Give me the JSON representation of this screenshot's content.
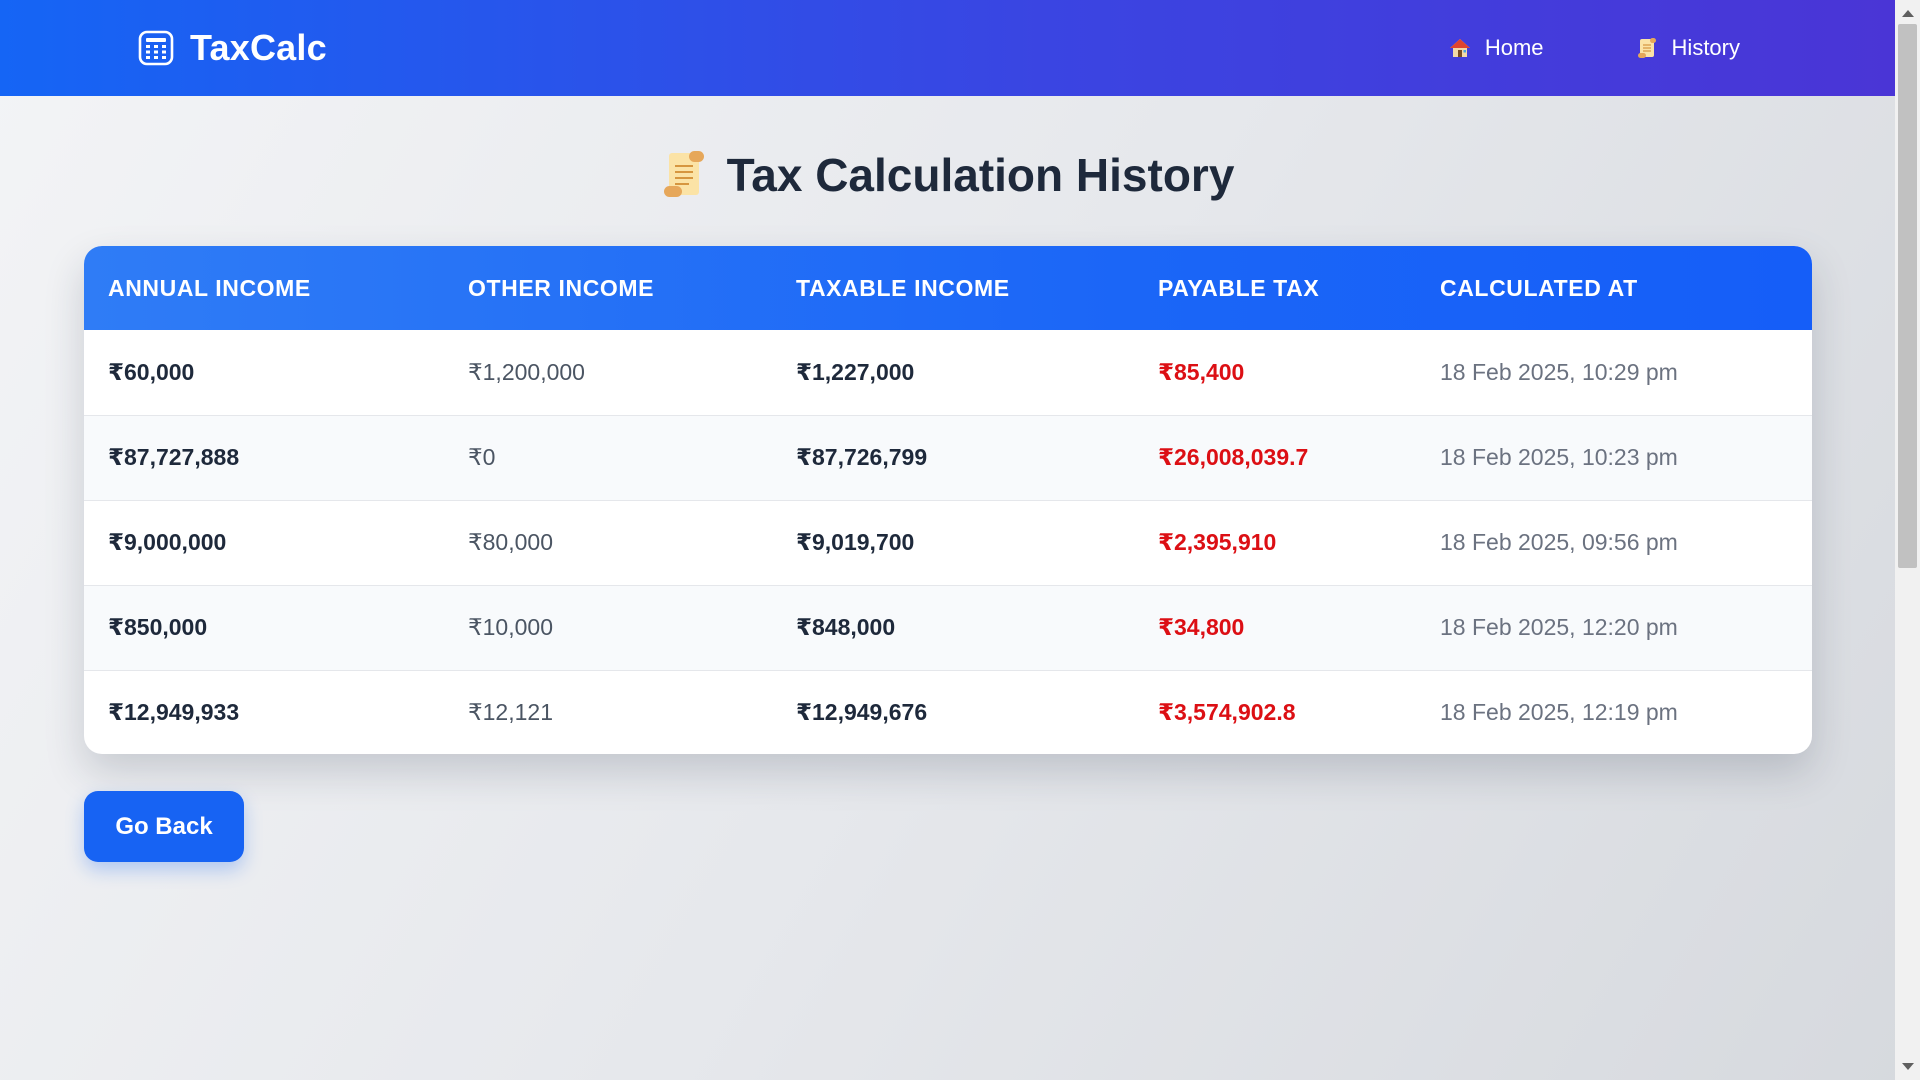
{
  "navbar": {
    "brand": "TaxCalc",
    "brand_icon": "calculator-icon",
    "links": [
      {
        "label": "Home",
        "icon": "house-icon"
      },
      {
        "label": "History",
        "icon": "scroll-icon"
      }
    ]
  },
  "page": {
    "title": "Tax Calculation History",
    "title_icon": "scroll-icon"
  },
  "table": {
    "headers": [
      "Annual Income",
      "Other Income",
      "Taxable Income",
      "Payable Tax",
      "Calculated At"
    ],
    "rows": [
      [
        "₹60,000",
        "₹1,200,000",
        "₹1,227,000",
        "₹85,400",
        "18 Feb 2025, 10:29 pm"
      ],
      [
        "₹87,727,888",
        "₹0",
        "₹87,726,799",
        "₹26,008,039.7",
        "18 Feb 2025, 10:23 pm"
      ],
      [
        "₹9,000,000",
        "₹80,000",
        "₹9,019,700",
        "₹2,395,910",
        "18 Feb 2025, 09:56 pm"
      ],
      [
        "₹850,000",
        "₹10,000",
        "₹848,000",
        "₹34,800",
        "18 Feb 2025, 12:20 pm"
      ],
      [
        "₹12,949,933",
        "₹12,121",
        "₹12,949,676",
        "₹3,574,902.8",
        "18 Feb 2025, 12:19 pm"
      ]
    ]
  },
  "actions": {
    "go_back_label": "Go Back"
  },
  "colors": {
    "nav_gradient_start": "#1565f5",
    "nav_gradient_end": "#4a35d6",
    "header_blue": "#1b66f7",
    "payable_tax_red": "#dc0f14",
    "button_blue": "#1763f3"
  }
}
